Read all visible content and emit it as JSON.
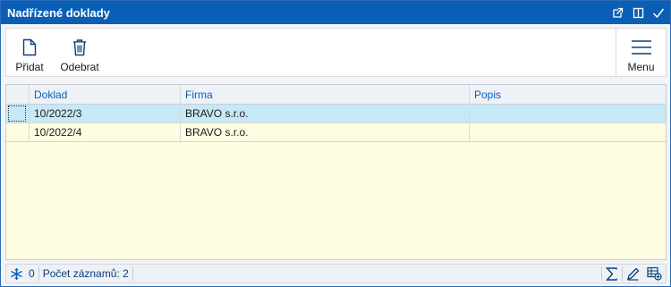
{
  "window": {
    "title": "Nadřízené doklady"
  },
  "toolbar": {
    "add_label": "Přidat",
    "remove_label": "Odebrat",
    "menu_label": "Menu"
  },
  "grid": {
    "columns": [
      "Doklad",
      "Firma",
      "Popis"
    ],
    "rows": [
      {
        "doklad": "10/2022/3",
        "firma": "BRAVO s.r.o.",
        "popis": ""
      },
      {
        "doklad": "10/2022/4",
        "firma": "BRAVO s.r.o.",
        "popis": ""
      }
    ]
  },
  "status": {
    "selected_count": "0",
    "record_count_text": "Počet záznamů: 2"
  },
  "colors": {
    "titlebar": "#0a5fb4",
    "accent": "#0a5fb4",
    "grid_background": "#fffde1",
    "selected_row": "#c7e8f7"
  },
  "icons": [
    "popout-icon",
    "dock-icon",
    "check-icon",
    "new-document-icon",
    "trash-icon",
    "hamburger-menu-icon",
    "snowflake-icon",
    "sigma-icon",
    "pencil-icon",
    "grid-add-icon"
  ]
}
